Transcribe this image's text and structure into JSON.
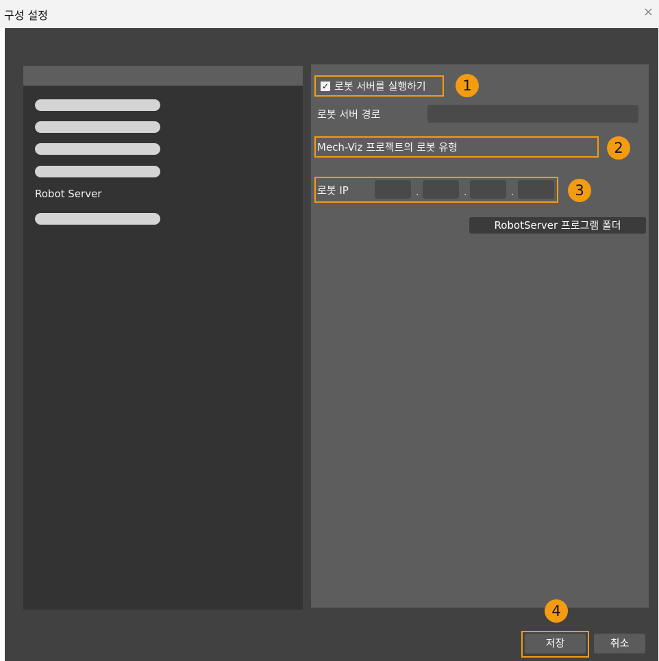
{
  "window": {
    "title": "구성 설정",
    "close_icon": "×"
  },
  "sidebar": {
    "active_item": "Robot Server"
  },
  "settings": {
    "run_server_label": "로봇 서버를 실행하기",
    "run_server_checked": true,
    "checkbox_mark": "✓",
    "server_path_label": "로봇 서버 경로",
    "server_path_value": "",
    "robot_type_label": "Mech-Viz 프로젝트의 로봇 유형",
    "robot_ip_label": "로봇 IP",
    "ip_octets": [
      "",
      "",
      "",
      ""
    ],
    "ip_separator": ".",
    "folder_button": "RobotServer 프로그램 폴더"
  },
  "footer": {
    "save_label": "저장",
    "cancel_label": "취소"
  },
  "annotations": [
    "1",
    "2",
    "3",
    "4"
  ],
  "colors": {
    "accent": "#f39c12",
    "background": "#424142",
    "panel": "#5e5d5d"
  }
}
